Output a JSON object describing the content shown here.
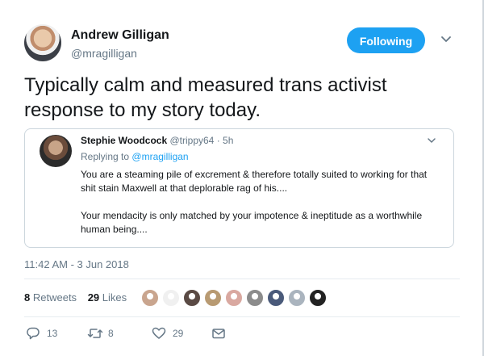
{
  "author": {
    "name": "Andrew Gilligan",
    "handle": "@mragilligan",
    "follow_label": "Following"
  },
  "tweet": {
    "text": "Typically calm and measured trans activist response to my story today.",
    "timestamp": "11:42 AM - 3 Jun 2018"
  },
  "quoted": {
    "name": "Stephie Woodcock",
    "handle": "@trippy64",
    "age": "5h",
    "separator": "·",
    "replying_to_prefix": "Replying to",
    "replying_to": "@mragilligan",
    "paragraphs": [
      "You are a steaming pile of excrement & therefore totally suited to working for that shit stain Maxwell at that deplorable rag of his....",
      "Your mendacity is only matched by your impotence & ineptitude as a worthwhile human being...."
    ]
  },
  "stats": {
    "retweets_count": "8",
    "retweets_label": "Retweets",
    "likes_count": "29",
    "likes_label": "Likes"
  },
  "likers": [
    "#c9a58e",
    "#f0f0f0",
    "#5a4a44",
    "#b89a72",
    "#d9a8a0",
    "#8c8c8c",
    "#4a5a7a",
    "#aab4be",
    "#222222"
  ],
  "actions": {
    "replies": "13",
    "retweets": "8",
    "likes": "29"
  },
  "colors": {
    "accent": "#1da1f2",
    "muted": "#657786",
    "text": "#14171a",
    "border": "#ccd6dd"
  },
  "icons": {
    "reply": "speech-bubble-icon",
    "retweet": "retweet-arrows-icon",
    "like": "heart-icon",
    "dm": "envelope-icon",
    "menu": "chevron-down-icon"
  }
}
